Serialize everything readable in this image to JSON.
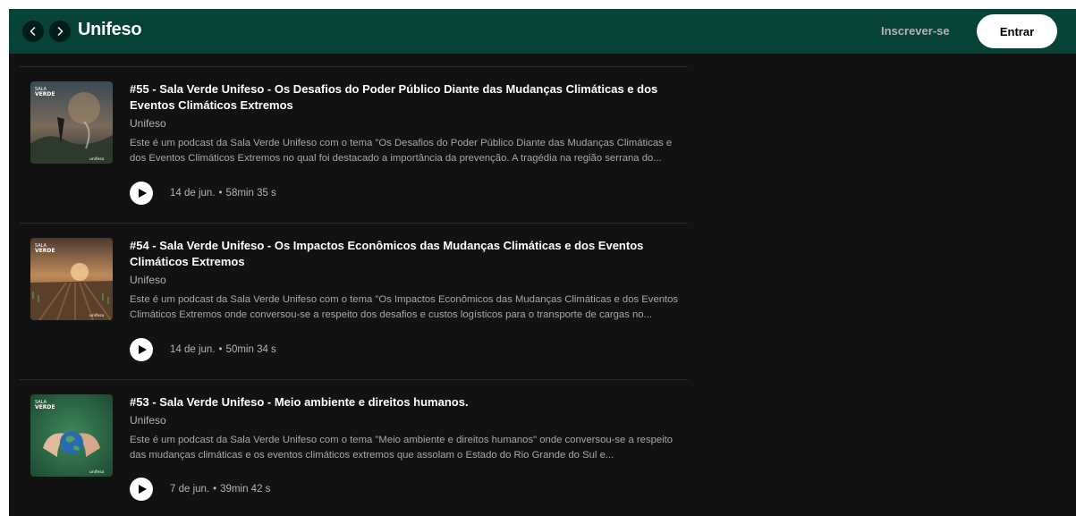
{
  "header": {
    "title": "Unifeso",
    "signup_label": "Inscrever-se",
    "login_label": "Entrar",
    "bg_color": "#064236"
  },
  "episodes": [
    {
      "title": "#55 - Sala Verde Unifeso - Os Desafios do Poder Público Diante das Mudanças Climáticas e dos Eventos Climáticos Extremos",
      "show": "Unifeso",
      "description": "Este é um podcast da Sala Verde Unifeso com o tema \"Os Desafios do Poder Público Diante das Mudanças Climáticas e dos Eventos Climáticos Extremos no qual foi destacado a importância da prevenção. A tragédia na região serrana do...",
      "date": "14 de jun.",
      "dot": "•",
      "duration": "58min 35 s",
      "thumb_label": "VERDE",
      "thumb_brand": "unifeso"
    },
    {
      "title": "#54 - Sala Verde Unifeso - Os Impactos Econômicos das Mudanças Climáticas e dos Eventos Climáticos Extremos",
      "show": "Unifeso",
      "description": "Este é um podcast da Sala Verde Unifeso com o tema \"Os Impactos Econômicos das Mudanças Climáticas e dos Eventos Climáticos Extremos onde conversou-se a respeito dos desafios e custos logísticos para o transporte de cargas no...",
      "date": "14 de jun.",
      "dot": "•",
      "duration": "50min 34 s",
      "thumb_label": "VERDE",
      "thumb_brand": "unifeso"
    },
    {
      "title": "#53 - Sala Verde Unifeso - Meio ambiente e direitos humanos.",
      "show": "Unifeso",
      "description": "Este é um podcast da Sala Verde Unifeso com o tema \"Meio ambiente e direitos humanos\" onde conversou-se a respeito das mudanças climáticas e os eventos climáticos extremos que assolam o Estado do Rio Grande do Sul e...",
      "date": "7 de jun.",
      "dot": "•",
      "duration": "39min 42 s",
      "thumb_label": "VERDE",
      "thumb_brand": "unifeso"
    }
  ],
  "icons": {
    "back": "chevron-left-icon",
    "forward": "chevron-right-icon",
    "play": "play-icon"
  }
}
